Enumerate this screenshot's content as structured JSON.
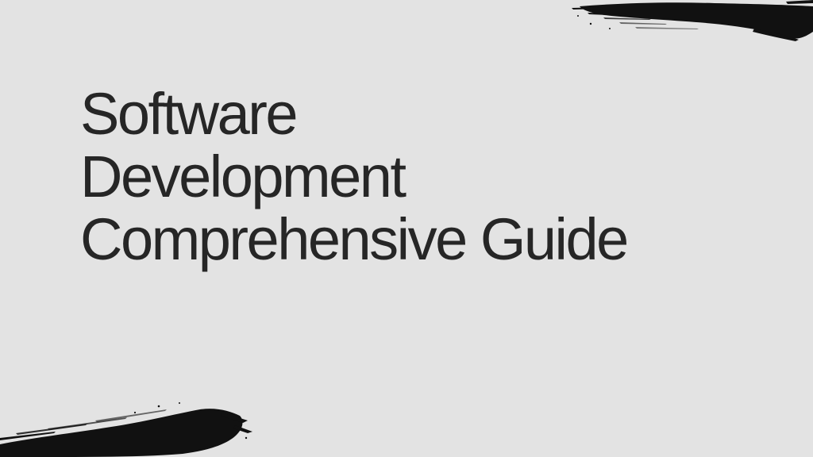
{
  "slide": {
    "background_color": "#e3e3e3",
    "text_color": "#262626",
    "brush_color": "#111111",
    "title_lines": [
      "Software",
      "Development",
      "Comprehensive Guide"
    ]
  },
  "decorations": {
    "top_right": "brush-stroke",
    "bottom_left": "brush-stroke"
  }
}
